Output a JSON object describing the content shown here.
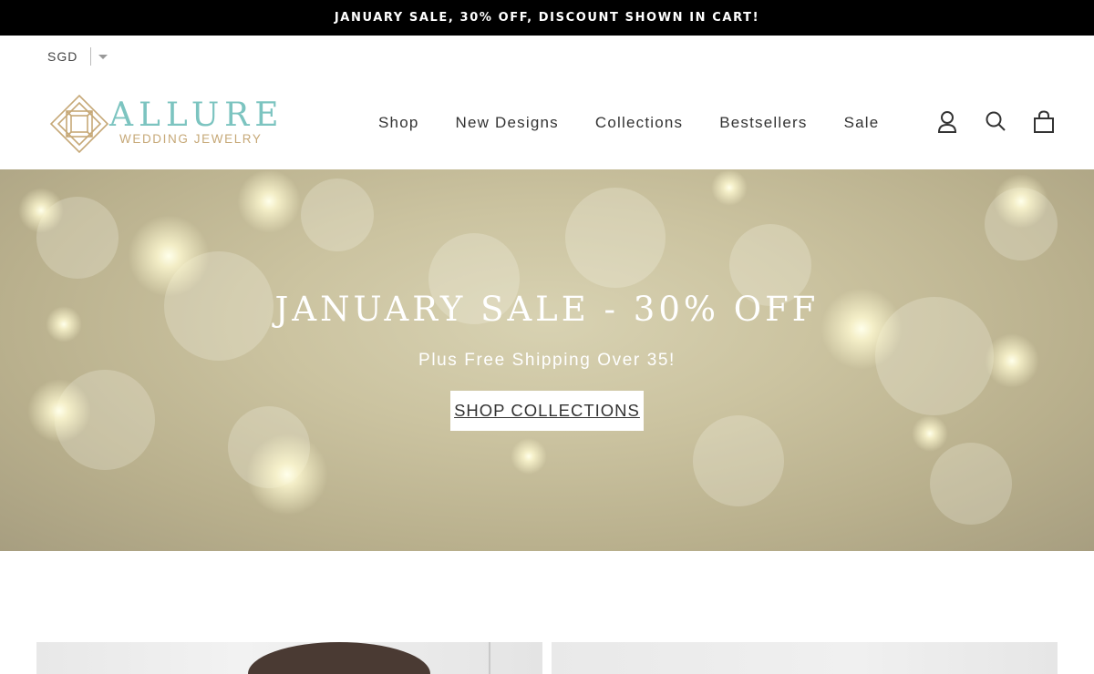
{
  "announcement": "JANUARY SALE, 30% OFF, DISCOUNT SHOWN IN CART!",
  "currency": {
    "selected": "SGD"
  },
  "logo": {
    "brand": "ALLURE",
    "tagline": "WEDDING JEWELRY",
    "colors": {
      "brand": "#7cc4c0",
      "tagline": "#c6a877"
    }
  },
  "nav": {
    "items": [
      {
        "label": "Shop"
      },
      {
        "label": "New Designs"
      },
      {
        "label": "Collections"
      },
      {
        "label": "Bestsellers"
      },
      {
        "label": "Sale"
      }
    ]
  },
  "header_icons": [
    "account-icon",
    "search-icon",
    "cart-icon"
  ],
  "hero": {
    "title": "JANUARY SALE - 30% OFF",
    "subtitle": "Plus Free Shipping Over 35!",
    "cta": "SHOP COLLECTIONS"
  }
}
